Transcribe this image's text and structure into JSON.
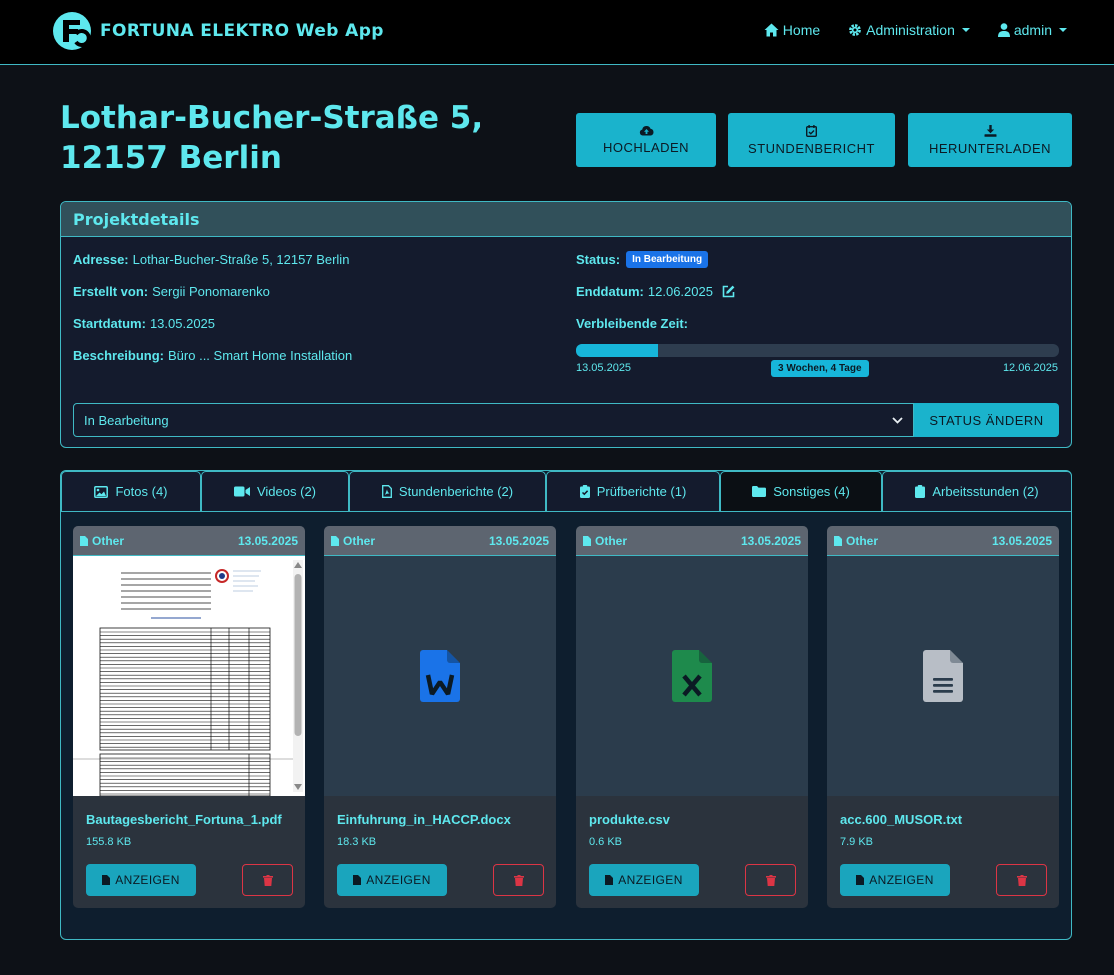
{
  "navbar": {
    "brand": "FORTUNA ELEKTRO Web App",
    "home": "Home",
    "administration": "Administration",
    "user": "admin"
  },
  "page": {
    "title": "Lothar-Bucher-Straße 5, 12157 Berlin",
    "buttons": {
      "upload": "HOCHLADEN",
      "report": "STUNDENBERICHT",
      "download": "HERUNTERLADEN"
    }
  },
  "details": {
    "header": "Projektdetails",
    "address_label": "Adresse:",
    "address": "Lothar-Bucher-Straße 5, 12157 Berlin",
    "created_label": "Erstellt von:",
    "created_by": "Sergii Ponomarenko",
    "start_label": "Startdatum:",
    "start_date": "13.05.2025",
    "desc_label": "Beschreibung:",
    "description": "Büro ... Smart Home Installation",
    "status_label": "Status:",
    "status": "In Bearbeitung",
    "end_label": "Enddatum:",
    "end_date": "12.06.2025",
    "remaining_label": "Verbleibende Zeit:",
    "progress_start": "13.05.2025",
    "progress_end": "12.06.2025",
    "remaining": "3 Wochen, 4 Tage",
    "progress_fraction": 0.17,
    "select_value": "In Bearbeitung",
    "change_button": "STATUS ÄNDERN"
  },
  "tabs": [
    {
      "label": "Fotos (4)"
    },
    {
      "label": "Videos (2)"
    },
    {
      "label": "Stundenberichte (2)"
    },
    {
      "label": "Prüfberichte (1)"
    },
    {
      "label": "Sonstiges (4)"
    },
    {
      "label": "Arbeitsstunden (2)"
    }
  ],
  "files": [
    {
      "category": "Other",
      "date": "13.05.2025",
      "name": "Bautagesbericht_Fortuna_1.pdf",
      "size": "155.8 KB",
      "view": "ANZEIGEN"
    },
    {
      "category": "Other",
      "date": "13.05.2025",
      "name": "Einfuhrung_in_HACCP.docx",
      "size": "18.3 KB",
      "view": "ANZEIGEN"
    },
    {
      "category": "Other",
      "date": "13.05.2025",
      "name": "produkte.csv",
      "size": "0.6 KB",
      "view": "ANZEIGEN"
    },
    {
      "category": "Other",
      "date": "13.05.2025",
      "name": "acc.600_MUSOR.txt",
      "size": "7.9 KB",
      "view": "ANZEIGEN"
    }
  ],
  "colors": {
    "accent": "#5ee8ee",
    "button": "#1ab3cc",
    "word": "#1a73e8",
    "excel": "#1e8a4c",
    "danger": "#dc3545",
    "doc_gray": "#b8bec6"
  }
}
